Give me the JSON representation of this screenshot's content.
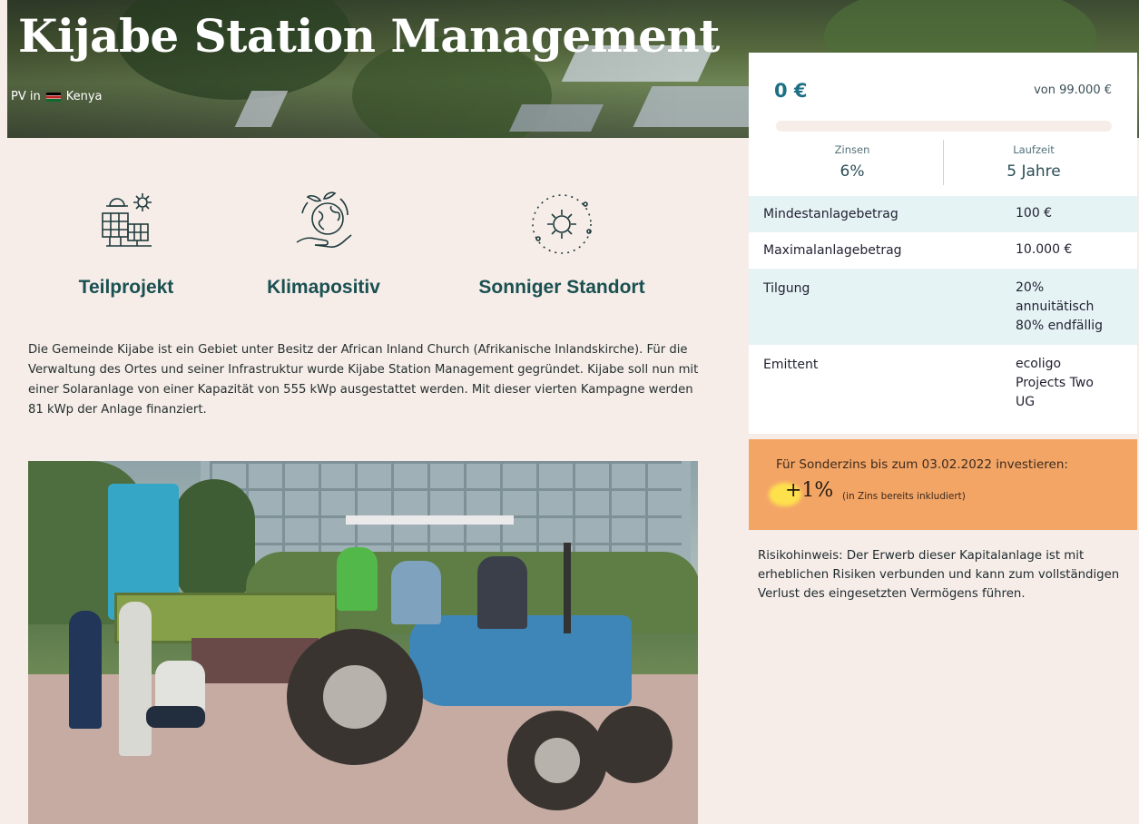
{
  "hero": {
    "title": "Kijabe Station Management",
    "subtitle_prefix": "PV in",
    "country": "Kenya",
    "flag_icon": "kenya-flag-icon"
  },
  "features": [
    {
      "icon": "solar-panel-sun-icon",
      "label": "Teilprojekt"
    },
    {
      "icon": "earth-plant-hand-icon",
      "label": "Klimapositiv"
    },
    {
      "icon": "sun-icon",
      "label": "Sonniger Standort"
    }
  ],
  "description": "Die Gemeinde Kijabe ist ein Gebiet unter Besitz der African Inland Church (Afrikanische Inlandskirche). Für die Verwaltung des Ortes und seiner Infrastruktur wurde Kijabe Station Management gegründet. Kijabe soll nun mit einer Solaranlage von einer Kapazität von 555 kWp ausgestattet werden. Mit dieser vierten Kampagne werden 81 kWp der Anlage finanziert.",
  "funding": {
    "amount": "0 €",
    "goal": "von 99.000 €",
    "progress_fraction": 0,
    "interest_label": "Zinsen",
    "interest_value": "6%",
    "term_label": "Laufzeit",
    "term_value": "5 Jahre"
  },
  "details": [
    {
      "label": "Mindestanlagebetrag",
      "value": "100 €"
    },
    {
      "label": "Maximalanlagebetrag",
      "value": "10.000 €"
    },
    {
      "label": "Tilgung",
      "value_lines": [
        "20%",
        "annuitätisch",
        "80% endfällig"
      ]
    },
    {
      "label": "Emittent",
      "value_lines": [
        "ecoligo",
        "Projects Two",
        "UG"
      ]
    }
  ],
  "promo": {
    "text": "Für Sonderzins bis zum 03.02.2022 investieren:",
    "bonus": "+1%",
    "note": "(in Zins bereits inkludiert)"
  },
  "risk_notice": "Risikohinweis: Der Erwerb dieser Kapitalanlage ist mit erheblichen Risiken verbunden und kann zum vollständigen Verlust des eingesetzten Vermögens führen.",
  "colors": {
    "page_bg": "#f6ede9",
    "accent": "#1d6f86",
    "heading": "#1a5051",
    "promo_bg": "#f3a566",
    "row_highlight": "#e6f3f5"
  }
}
